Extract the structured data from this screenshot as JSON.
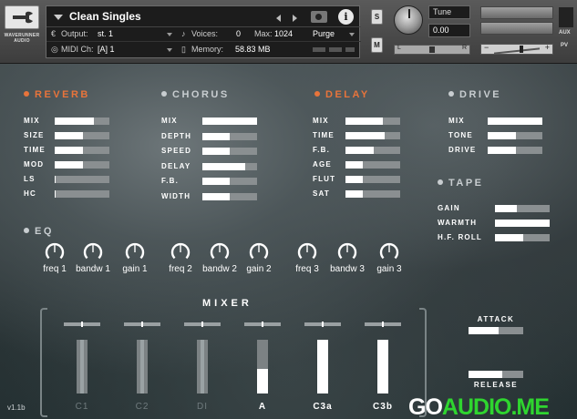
{
  "logo": {
    "text": "WAVERUNNER AUDIO"
  },
  "instrument": {
    "name": "Clean Singles",
    "output_label": "Output:",
    "output_value": "st. 1",
    "voices_label": "Voices:",
    "voices_value": "0",
    "max_label": "Max:",
    "max_value": "1024",
    "purge_label": "Purge",
    "midi_label": "MIDI Ch:",
    "midi_value": "[A] 1",
    "memory_label": "Memory:",
    "memory_value": "58.83 MB"
  },
  "header_buttons": {
    "solo": "S",
    "mute": "M",
    "aux": "AUX",
    "pv": "PV"
  },
  "tune": {
    "label": "Tune",
    "value": "0.00",
    "pan_left": "L",
    "pan_right": "R"
  },
  "volume_scale": {
    "minus": "−",
    "plus": "+"
  },
  "sections": {
    "reverb": {
      "title": "REVERB",
      "params": [
        {
          "label": "MIX",
          "value": 0.72
        },
        {
          "label": "SIZE",
          "value": 0.52
        },
        {
          "label": "TIME",
          "value": 0.52
        },
        {
          "label": "MOD",
          "value": 0.52
        },
        {
          "label": "LS",
          "value": 0.02
        },
        {
          "label": "HC",
          "value": 0.02
        }
      ]
    },
    "chorus": {
      "title": "CHORUS",
      "params": [
        {
          "label": "MIX",
          "value": 1.0
        },
        {
          "label": "DEPTH",
          "value": 0.5
        },
        {
          "label": "SPEED",
          "value": 0.5
        },
        {
          "label": "DELAY",
          "value": 0.78
        },
        {
          "label": "F.B.",
          "value": 0.5
        },
        {
          "label": "WIDTH",
          "value": 0.5
        }
      ]
    },
    "delay": {
      "title": "DELAY",
      "params": [
        {
          "label": "MIX",
          "value": 0.68
        },
        {
          "label": "TIME",
          "value": 0.72
        },
        {
          "label": "F.B.",
          "value": 0.52
        },
        {
          "label": "AGE",
          "value": 0.32
        },
        {
          "label": "FLUT",
          "value": 0.32
        },
        {
          "label": "SAT",
          "value": 0.32
        }
      ]
    },
    "drive": {
      "title": "DRIVE",
      "params": [
        {
          "label": "MIX",
          "value": 1.0
        },
        {
          "label": "TONE",
          "value": 0.52
        },
        {
          "label": "DRIVE",
          "value": 0.52
        }
      ]
    },
    "tape": {
      "title": "TAPE",
      "params": [
        {
          "label": "GAIN",
          "value": 0.4
        },
        {
          "label": "WARMTH",
          "value": 1.0
        },
        {
          "label": "H.F. ROLL",
          "value": 0.52
        }
      ]
    },
    "eq": {
      "title": "EQ",
      "knobs": [
        {
          "label": "freq 1"
        },
        {
          "label": "bandw 1"
        },
        {
          "label": "gain 1"
        },
        {
          "label": "freq 2"
        },
        {
          "label": "bandw 2"
        },
        {
          "label": "gain 2"
        },
        {
          "label": "freq 3"
        },
        {
          "label": "bandw 3"
        },
        {
          "label": "gain 3"
        }
      ]
    }
  },
  "mixer": {
    "title": "MIXER",
    "channels": [
      {
        "label": "C1",
        "level": 1.0,
        "active": false
      },
      {
        "label": "C2",
        "level": 1.0,
        "active": false
      },
      {
        "label": "DI",
        "level": 1.0,
        "active": false
      },
      {
        "label": "A",
        "level": 0.45,
        "active": true
      },
      {
        "label": "C3a",
        "level": 1.0,
        "active": true
      },
      {
        "label": "C3b",
        "level": 1.0,
        "active": true
      }
    ]
  },
  "envelope": {
    "attack": {
      "label": "ATTACK",
      "value": 0.55
    },
    "release": {
      "label": "RELEASE",
      "value": 0.62
    }
  },
  "footer": {
    "version": "v1.1b",
    "watermark_part1": "GO",
    "watermark_part2": "AUDIO.ME"
  }
}
